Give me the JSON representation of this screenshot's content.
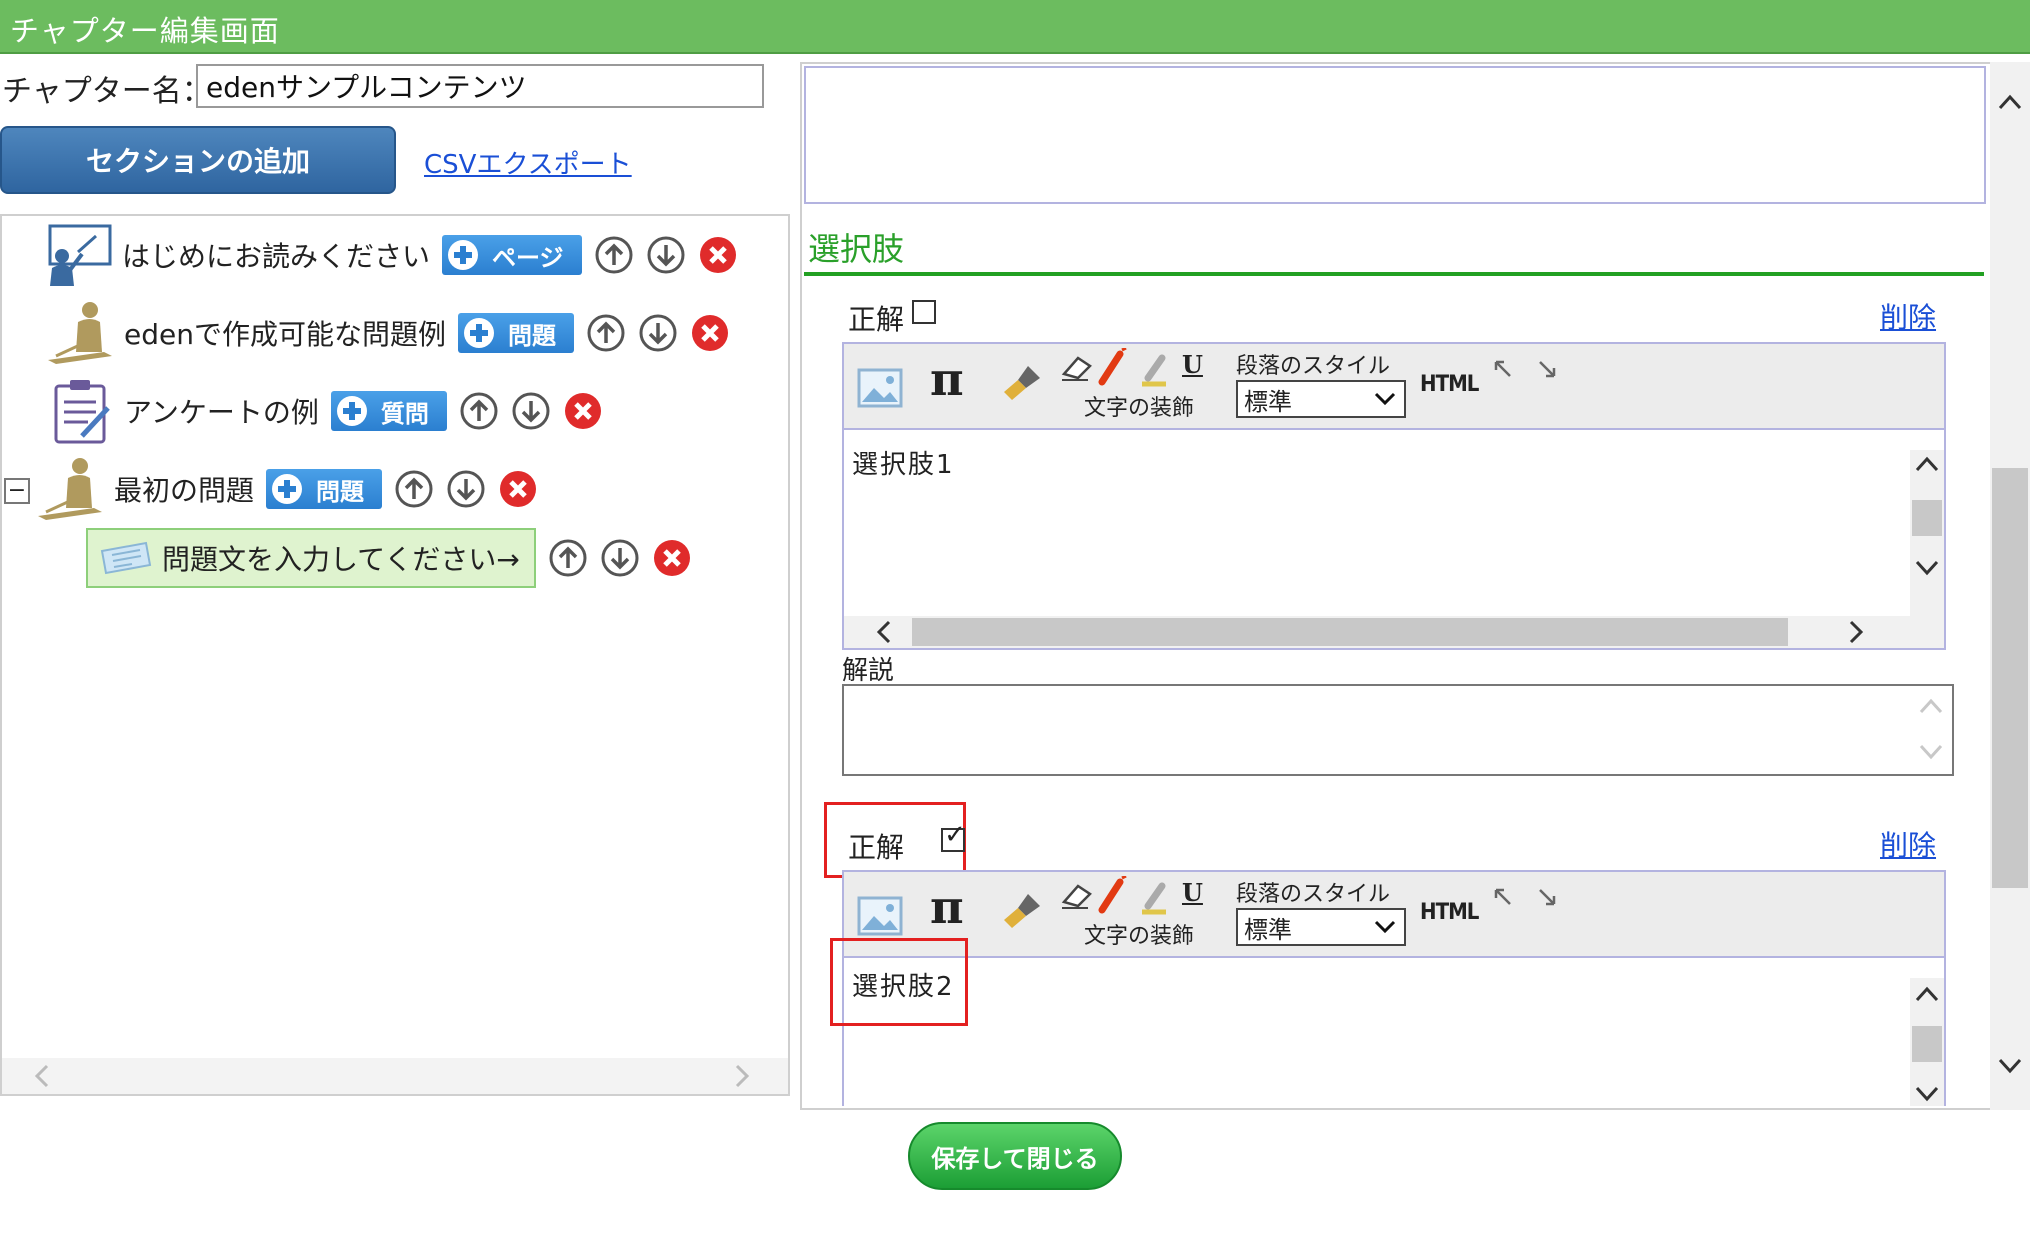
{
  "header": {
    "title": "チャプター編集画面"
  },
  "chapter": {
    "label": "チャプター名：",
    "value": "edenサンプルコンテンツ"
  },
  "actions": {
    "add_section": "セクションの追加",
    "csv_export": "CSVエクスポート",
    "save_close": "保存して閉じる"
  },
  "tree": {
    "nodes": [
      {
        "label": "はじめにお読みください",
        "button": "ページ",
        "icon": "teacher-board-icon"
      },
      {
        "label": "edenで作成可能な問題例",
        "button": "問題",
        "icon": "student-desk-icon"
      },
      {
        "label": "アンケートの例",
        "button": "質問",
        "icon": "clipboard-icon"
      },
      {
        "label": "最初の問題",
        "button": "問題",
        "icon": "student-desk-icon",
        "collapse": "−"
      },
      {
        "label": "問題文を入力してください→",
        "icon": "question-card-icon"
      }
    ]
  },
  "editor": {
    "choices_heading": "選択肢",
    "correct_label": "正解",
    "delete_label": "削除",
    "text_decoration": "文字の装飾",
    "paragraph_style": "段落のスタイル",
    "style_value": "標準",
    "html": "HTML",
    "explanation_label": "解説",
    "choices": [
      {
        "text": "選択肢1",
        "correct": false
      },
      {
        "text": "選択肢2",
        "correct": true
      }
    ],
    "check_mark": "✓"
  },
  "colors": {
    "header": "#6cbc5f",
    "accent_green": "#22a022",
    "link": "#1a4fd6",
    "highlight": "#e32020",
    "add_button": "#2b7fd0"
  }
}
